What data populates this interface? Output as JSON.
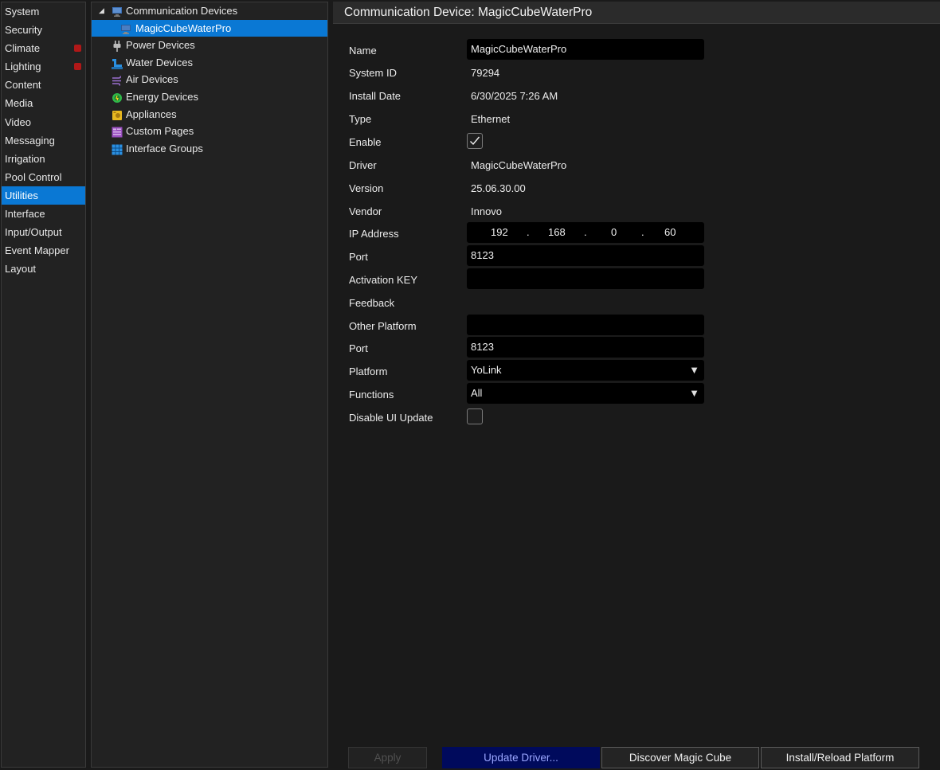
{
  "nav": {
    "items": [
      {
        "label": "System",
        "dot": false,
        "selected": false
      },
      {
        "label": "Security",
        "dot": false,
        "selected": false
      },
      {
        "label": "Climate",
        "dot": true,
        "selected": false
      },
      {
        "label": "Lighting",
        "dot": true,
        "selected": false
      },
      {
        "label": "Content",
        "dot": false,
        "selected": false
      },
      {
        "label": "Media",
        "dot": false,
        "selected": false
      },
      {
        "label": "Video",
        "dot": false,
        "selected": false
      },
      {
        "label": "Messaging",
        "dot": false,
        "selected": false
      },
      {
        "label": "Irrigation",
        "dot": false,
        "selected": false
      },
      {
        "label": "Pool Control",
        "dot": false,
        "selected": false
      },
      {
        "label": "Utilities",
        "dot": false,
        "selected": true
      },
      {
        "label": "Interface",
        "dot": false,
        "selected": false
      },
      {
        "label": "Input/Output",
        "dot": false,
        "selected": false
      },
      {
        "label": "Event Mapper",
        "dot": false,
        "selected": false
      },
      {
        "label": "Layout",
        "dot": false,
        "selected": false
      }
    ]
  },
  "tree": {
    "expand_arrow": "◢",
    "items": [
      {
        "label": "Communication Devices",
        "icon": "monitor-icon",
        "level": 0,
        "expanded": true
      },
      {
        "label": "MagicCubeWaterPro",
        "icon": "monitor-icon",
        "level": 1,
        "selected": true
      },
      {
        "label": "Power Devices",
        "icon": "plug-icon",
        "level": 0
      },
      {
        "label": "Water Devices",
        "icon": "faucet-icon",
        "level": 0
      },
      {
        "label": "Air Devices",
        "icon": "wind-icon",
        "level": 0
      },
      {
        "label": "Energy Devices",
        "icon": "gear-icon",
        "level": 0
      },
      {
        "label": "Appliances",
        "icon": "appliance-icon",
        "level": 0
      },
      {
        "label": "Custom Pages",
        "icon": "page-icon",
        "level": 0
      },
      {
        "label": "Interface Groups",
        "icon": "grid-icon",
        "level": 0
      }
    ]
  },
  "main": {
    "title": "Communication Device: MagicCubeWaterPro",
    "fields": {
      "name": {
        "label": "Name",
        "value": "MagicCubeWaterPro"
      },
      "system_id": {
        "label": "System ID",
        "value": "79294"
      },
      "install_date": {
        "label": "Install Date",
        "value": "6/30/2025 7:26 AM"
      },
      "type": {
        "label": "Type",
        "value": "Ethernet"
      },
      "enable": {
        "label": "Enable",
        "checked": true
      },
      "driver": {
        "label": "Driver",
        "value": "MagicCubeWaterPro"
      },
      "version": {
        "label": "Version",
        "value": "25.06.30.00"
      },
      "vendor": {
        "label": "Vendor",
        "value": "Innovo"
      },
      "ip_address": {
        "label": "IP Address",
        "octets": [
          "192",
          "168",
          "0",
          "60"
        ],
        "separator": "."
      },
      "port": {
        "label": "Port",
        "value": "8123"
      },
      "activation_key": {
        "label": "Activation KEY",
        "value": ""
      },
      "feedback": {
        "label": "Feedback"
      },
      "other_platform": {
        "label": "Other Platform",
        "value": ""
      },
      "port2": {
        "label": "Port",
        "value": "8123"
      },
      "platform": {
        "label": "Platform",
        "value": "YoLink"
      },
      "functions": {
        "label": "Functions",
        "value": "All"
      },
      "disable_ui_update": {
        "label": "Disable UI Update",
        "checked": false
      }
    },
    "dropdown_caret": "▼",
    "buttons": {
      "apply": "Apply",
      "update_driver": "Update Driver...",
      "discover": "Discover Magic Cube",
      "install_reload": "Install/Reload Platform"
    }
  },
  "colors": {
    "accent": "#0a78d4",
    "status_dot": "#b01818",
    "update_button_bg": "#000a5c"
  }
}
